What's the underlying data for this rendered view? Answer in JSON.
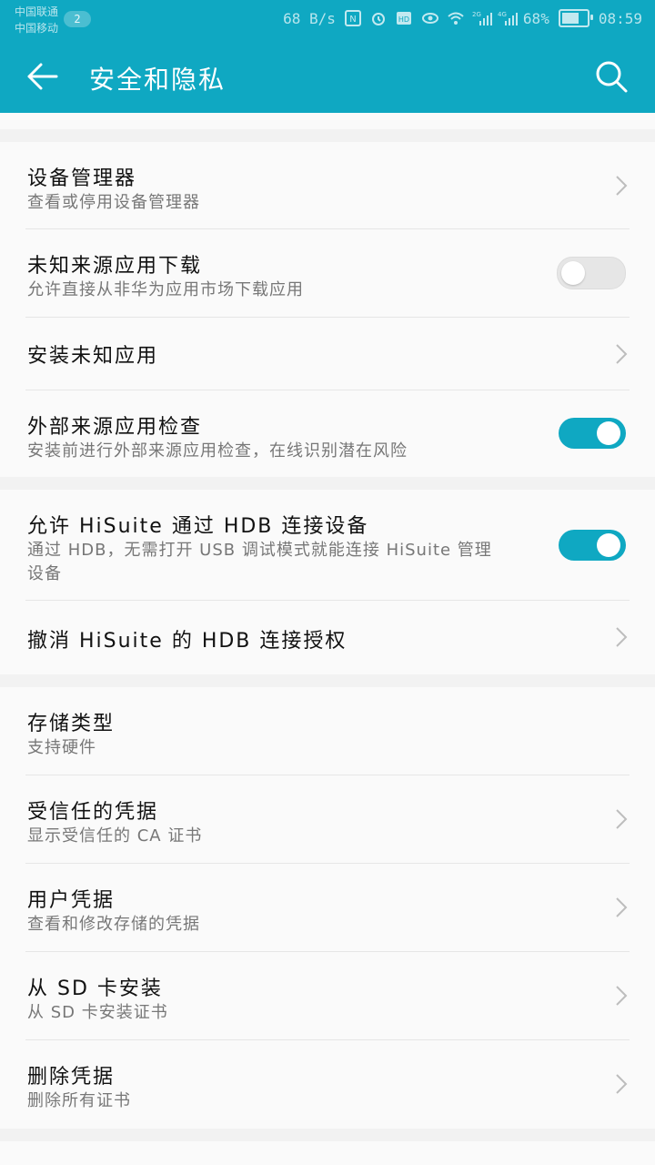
{
  "status_bar": {
    "carrier1": "中国联通",
    "carrier2": "中国移动",
    "carrier_badge": "2",
    "net_speed": "68 B/s",
    "sig1_label": "2G",
    "sig2_label": "4G",
    "battery": "68%",
    "time": "08:59"
  },
  "header": {
    "title": "安全和隐私"
  },
  "sections": {
    "device_admin": {
      "title": "设备管理器",
      "subtitle": "查看或停用设备管理器"
    },
    "unknown_download": {
      "title": "未知来源应用下载",
      "subtitle": "允许直接从非华为应用市场下载应用",
      "enabled": false
    },
    "install_unknown": {
      "title": "安装未知应用"
    },
    "external_check": {
      "title": "外部来源应用检查",
      "subtitle": "安装前进行外部来源应用检查，在线识别潜在风险",
      "enabled": true
    },
    "hisuite_hdb": {
      "title": "允许 HiSuite 通过 HDB 连接设备",
      "subtitle_line1": "通过 HDB，无需打开 USB 调试模式就能连接 HiSuite 管理",
      "subtitle_line2": "设备",
      "enabled": true
    },
    "revoke_hdb": {
      "title": "撤消 HiSuite 的 HDB 连接授权"
    },
    "storage_type": {
      "title": "存储类型",
      "subtitle": "支持硬件"
    },
    "trusted_creds": {
      "title": "受信任的凭据",
      "subtitle": "显示受信任的 CA 证书"
    },
    "user_creds": {
      "title": "用户凭据",
      "subtitle": "查看和修改存储的凭据"
    },
    "install_sd": {
      "title": "从 SD 卡安装",
      "subtitle": "从 SD 卡安装证书"
    },
    "clear_creds": {
      "title": "删除凭据",
      "subtitle": "删除所有证书"
    }
  },
  "colors": {
    "accent": "#0fa8c2",
    "background": "#f2f2f2",
    "card": "#fafafa"
  }
}
